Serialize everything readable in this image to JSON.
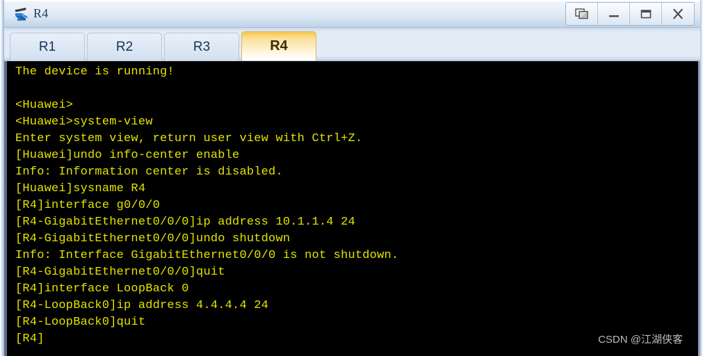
{
  "window": {
    "title": "R4",
    "icon": "router-device-icon",
    "controls": [
      {
        "name": "restore-cascade-button",
        "label": "❐",
        "icon": "cascade-windows-icon"
      },
      {
        "name": "minimize-button",
        "label": "–",
        "icon": "minimize-icon"
      },
      {
        "name": "maximize-button",
        "label": "▭",
        "icon": "maximize-icon"
      },
      {
        "name": "close-button",
        "label": "X",
        "icon": "close-icon"
      }
    ]
  },
  "tabs": {
    "items": [
      {
        "label": "R1",
        "active": false
      },
      {
        "label": "R2",
        "active": false
      },
      {
        "label": "R3",
        "active": false
      },
      {
        "label": "R4",
        "active": true
      }
    ]
  },
  "terminal": {
    "foreground_color": "#e3e300",
    "background_color": "#000000",
    "lines": [
      "The device is running!",
      "",
      "<Huawei>",
      "<Huawei>system-view",
      "Enter system view, return user view with Ctrl+Z.",
      "[Huawei]undo info-center enable",
      "Info: Information center is disabled.",
      "[Huawei]sysname R4",
      "[R4]interface g0/0/0",
      "[R4-GigabitEthernet0/0/0]ip address 10.1.1.4 24",
      "[R4-GigabitEthernet0/0/0]undo shutdown",
      "Info: Interface GigabitEthernet0/0/0 is not shutdown.",
      "[R4-GigabitEthernet0/0/0]quit",
      "[R4]interface LoopBack 0",
      "[R4-LoopBack0]ip address 4.4.4.4 24",
      "[R4-LoopBack0]quit",
      "[R4]"
    ]
  },
  "watermark": {
    "text": "CSDN @江湖侠客"
  }
}
